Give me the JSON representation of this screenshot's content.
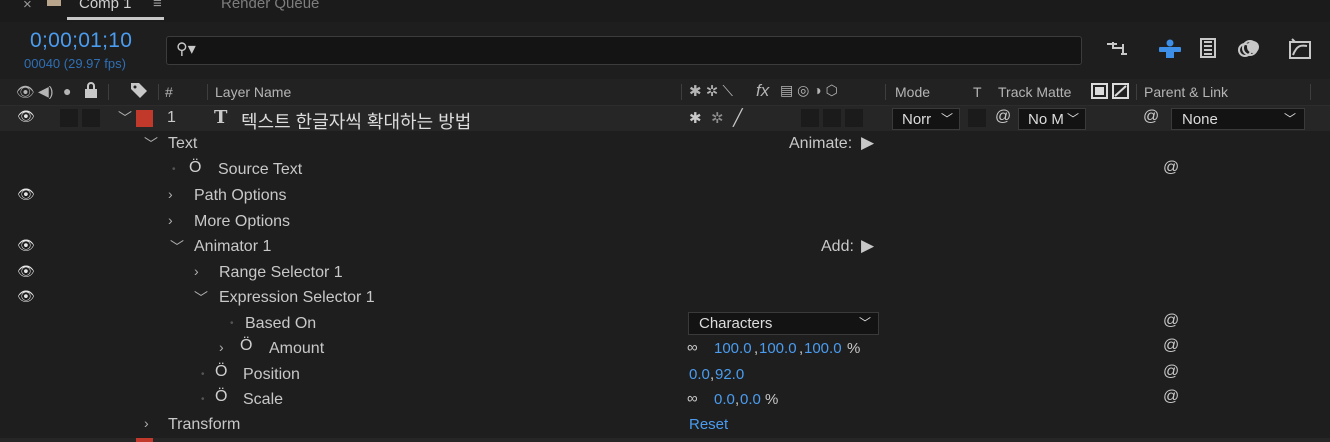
{
  "tabs": {
    "close_glyph": "×",
    "comp_label": "Comp 1",
    "menu_glyph": "≡",
    "render_queue": "Render Queue"
  },
  "header": {
    "timecode": "0;00;01;10",
    "frames": "00040 (29.97 fps)",
    "search_glyph": "⚲▾",
    "search_placeholder": ""
  },
  "columns": {
    "number": "#",
    "layer_name": "Layer Name",
    "fx": "fx",
    "mode": "Mode",
    "t": "T",
    "track_matte": "Track Matte",
    "parent_link": "Parent & Link"
  },
  "layer": {
    "number": "1",
    "type_glyph": "T",
    "name": "텍스트 한글자씩 확대하는 방법",
    "label_color": "#c0392b",
    "mode": "Norr",
    "track_matte": "No M",
    "parent": "None"
  },
  "props": {
    "text": "Text",
    "animate_label": "Animate:",
    "source_text": "Source Text",
    "path_options": "Path Options",
    "more_options": "More Options",
    "animator1": "Animator 1",
    "add_label": "Add:",
    "range_selector": "Range Selector 1",
    "expression_selector": "Expression Selector 1",
    "based_on": "Based On",
    "based_on_value": "Characters",
    "amount": "Amount",
    "amount_x": "100.0",
    "amount_y": "100.0",
    "amount_z": "100.0",
    "pct": "%",
    "position": "Position",
    "position_x": "0.0",
    "position_y": "92.0",
    "scale": "Scale",
    "scale_x": "0.0",
    "scale_y": "0.0",
    "transform": "Transform",
    "reset": "Reset"
  },
  "colors": {
    "accent_blue": "#4a9cf0",
    "background": "#1e1e1e"
  }
}
